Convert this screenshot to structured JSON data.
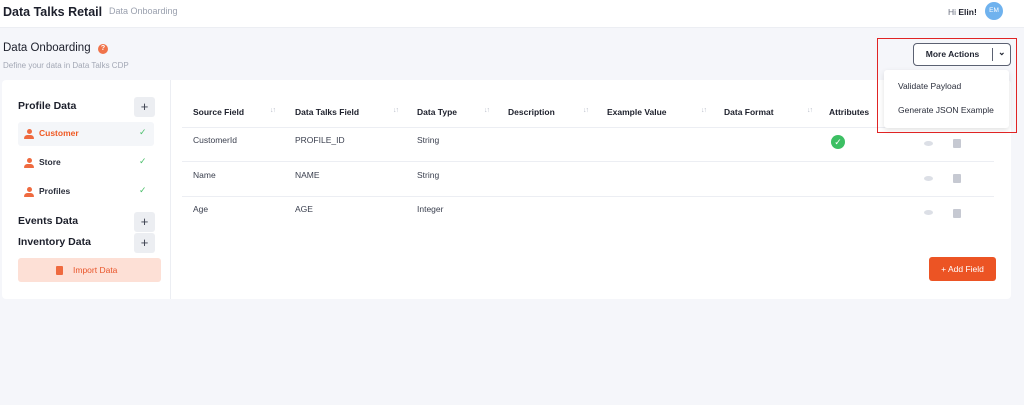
{
  "header": {
    "app_title": "Data Talks Retail",
    "breadcrumb": "Data Onboarding",
    "greeting_prefix": "Hi ",
    "user_name": "Elin!",
    "avatar_initials": "EM"
  },
  "page": {
    "title": "Data Onboarding",
    "help_glyph": "?",
    "subtitle": "Define your data in Data Talks CDP"
  },
  "actions": {
    "more_label": "More Actions",
    "chevron": "⌄",
    "menu": [
      "Validate Payload",
      "Generate JSON Example"
    ]
  },
  "sidebar": {
    "profile_title": "Profile Data",
    "profile_items": [
      {
        "label": "Customer",
        "active": true
      },
      {
        "label": "Store",
        "active": false
      },
      {
        "label": "Profiles",
        "active": false
      }
    ],
    "events_title": "Events Data",
    "inventory_title": "Inventory Data",
    "add_glyph": "+",
    "check_glyph": "✓",
    "import_label": "Import Data"
  },
  "table": {
    "columns": [
      "Source Field",
      "Data Talks Field",
      "Data Type",
      "Description",
      "Example Value",
      "Data Format",
      "Attributes"
    ],
    "sort_glyph": "↓↑",
    "rows": [
      {
        "source": "CustomerId",
        "field": "PROFILE_ID",
        "type": "String",
        "description": "",
        "example": "",
        "format": "",
        "attribute_check": true
      },
      {
        "source": "Name",
        "field": "NAME",
        "type": "String",
        "description": "",
        "example": "",
        "format": "",
        "attribute_check": false
      },
      {
        "source": "Age",
        "field": "AGE",
        "type": "Integer",
        "description": "",
        "example": "",
        "format": "",
        "attribute_check": false
      }
    ],
    "check_glyph": "✓",
    "add_field_label": "+ Add Field"
  },
  "colors": {
    "accent": "#ec5424",
    "accent_light": "#fde0d6",
    "success": "#3cbf63",
    "highlight": "#e02424",
    "avatar": "#6fb2ee"
  },
  "icons": [
    "help-icon",
    "chevron-down-icon",
    "plus-icon",
    "user-icon",
    "check-icon",
    "file-icon",
    "sort-icon",
    "check-circle-icon",
    "eye-icon",
    "trash-icon"
  ]
}
